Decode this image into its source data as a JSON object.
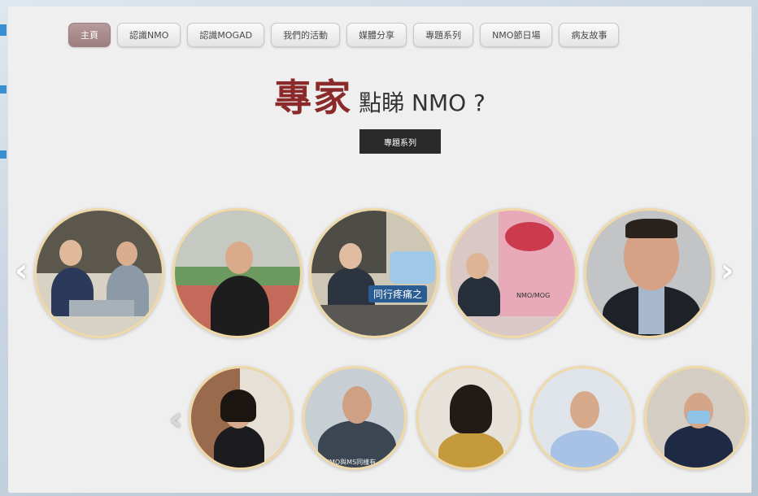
{
  "nav": {
    "items": [
      {
        "label": "主頁",
        "active": true
      },
      {
        "label": "認識NMO",
        "active": false
      },
      {
        "label": "認識MOGAD",
        "active": false
      },
      {
        "label": "我們的活動",
        "active": false
      },
      {
        "label": "媒體分享",
        "active": false
      },
      {
        "label": "專題系列",
        "active": false
      },
      {
        "label": "NMO節日場",
        "active": false
      },
      {
        "label": "病友故事",
        "active": false
      }
    ]
  },
  "headline": {
    "accent": "專家",
    "rest": "點睇 NMO ?"
  },
  "series_button": {
    "label": "專題系列"
  },
  "carousel_top": {
    "prev_arrow": "‹",
    "next_arrow": "›",
    "videos": [
      {
        "caption": ""
      },
      {
        "caption": ""
      },
      {
        "caption": "同行疼痛之"
      },
      {
        "caption": "NMO/MOG"
      },
      {
        "caption": ""
      }
    ]
  },
  "carousel_bottom": {
    "prev_arrow": "‹",
    "videos": [
      {
        "caption": ""
      },
      {
        "caption": "NMO與MS同樣有"
      },
      {
        "caption": ""
      },
      {
        "caption": ""
      },
      {
        "caption": ""
      }
    ]
  },
  "colors": {
    "accent": "#8a2a2a",
    "active_tab": "#9c7e80",
    "ring": "#f0d9a8"
  }
}
